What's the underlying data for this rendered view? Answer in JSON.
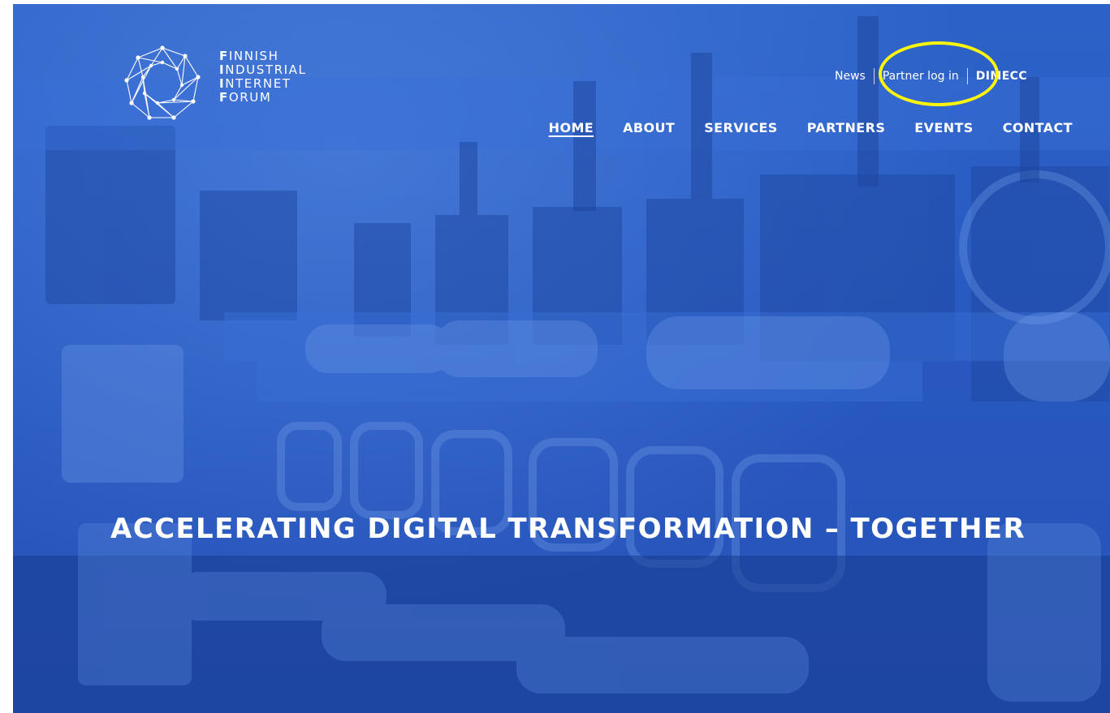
{
  "brand": {
    "name": "Finnish Industrial Internet Forum",
    "logo_lines": [
      {
        "initial": "F",
        "rest": "INNISH"
      },
      {
        "initial": "I",
        "rest": "NDUSTRIAL"
      },
      {
        "initial": "I",
        "rest": "NTERNET"
      },
      {
        "initial": "F",
        "rest": "ORUM"
      }
    ]
  },
  "top_nav": {
    "news": "News",
    "partner_login": "Partner log in",
    "dimecc": "DIMECC"
  },
  "main_nav": [
    {
      "label": "HOME",
      "active": true
    },
    {
      "label": "ABOUT",
      "active": false
    },
    {
      "label": "SERVICES",
      "active": false
    },
    {
      "label": "PARTNERS",
      "active": false
    },
    {
      "label": "EVENTS",
      "active": false
    },
    {
      "label": "CONTACT",
      "active": false
    }
  ],
  "hero": {
    "headline": "ACCELERATING DIGITAL TRANSFORMATION – TOGETHER"
  },
  "colors": {
    "hero_blue": "#2859c0",
    "text": "#ffffff",
    "highlight": "#fff40a"
  }
}
